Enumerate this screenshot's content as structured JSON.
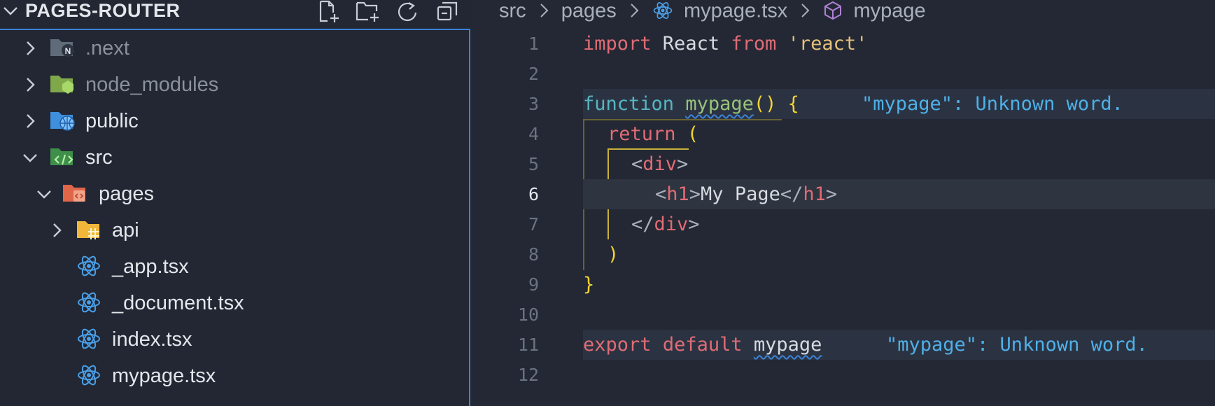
{
  "explorer": {
    "title": "PAGES-ROUTER",
    "actions": [
      "new-file-icon",
      "new-folder-icon",
      "refresh-icon",
      "collapse-all-icon"
    ],
    "items": [
      {
        "label": ".next",
        "type": "folder",
        "expanded": false,
        "icon": "next-folder-icon",
        "dim": true
      },
      {
        "label": "node_modules",
        "type": "folder",
        "expanded": false,
        "icon": "node-folder-icon",
        "dim": true
      },
      {
        "label": "public",
        "type": "folder",
        "expanded": false,
        "icon": "public-folder-icon"
      },
      {
        "label": "src",
        "type": "folder",
        "expanded": true,
        "icon": "src-folder-icon"
      },
      {
        "label": "pages",
        "type": "folder",
        "expanded": true,
        "icon": "pages-folder-icon"
      },
      {
        "label": "api",
        "type": "folder",
        "expanded": false,
        "icon": "api-folder-icon"
      },
      {
        "label": "_app.tsx",
        "type": "file",
        "icon": "react-icon"
      },
      {
        "label": "_document.tsx",
        "type": "file",
        "icon": "react-icon"
      },
      {
        "label": "index.tsx",
        "type": "file",
        "icon": "react-icon"
      },
      {
        "label": "mypage.tsx",
        "type": "file",
        "icon": "react-icon"
      }
    ]
  },
  "breadcrumbs": {
    "items": [
      "src",
      "pages",
      "mypage.tsx",
      "mypage"
    ]
  },
  "editor": {
    "line_numbers": [
      "1",
      "2",
      "3",
      "4",
      "5",
      "6",
      "7",
      "8",
      "9",
      "10",
      "11",
      "12"
    ],
    "active_line": "6",
    "code": {
      "l1_import": "import",
      "l1_react": " React ",
      "l1_from": "from",
      "l1_str": "'react'",
      "l3_function": "function",
      "l3_name": "mypage",
      "l3_parens": "()",
      "l3_brace": "{",
      "l4_return": "return",
      "l4_paren": "(",
      "l5_open": "<",
      "l5_tag": "div",
      "l5_close": ">",
      "l6_open": "<",
      "l6_tag": "h1",
      "l6_gt": ">",
      "l6_text": "My Page",
      "l6_close_open": "</",
      "l6_close_tag": "h1",
      "l6_close_gt": ">",
      "l7_open": "</",
      "l7_tag": "div",
      "l7_gt": ">",
      "l8_paren": ")",
      "l9_brace": "}",
      "l11_export": "export",
      "l11_default": "default",
      "l11_name": "mypage"
    },
    "diagnostics": {
      "l3": "\"mypage\": Unknown word.",
      "l11": "\"mypage\": Unknown word."
    }
  },
  "colors": {
    "background": "#232834",
    "focus_border": "#3b82d6",
    "keyword": "#e06c75",
    "function": "#98c379",
    "string": "#e5c07b",
    "bracket": "#f1d335",
    "diagnostic": "#4fb0e8"
  }
}
